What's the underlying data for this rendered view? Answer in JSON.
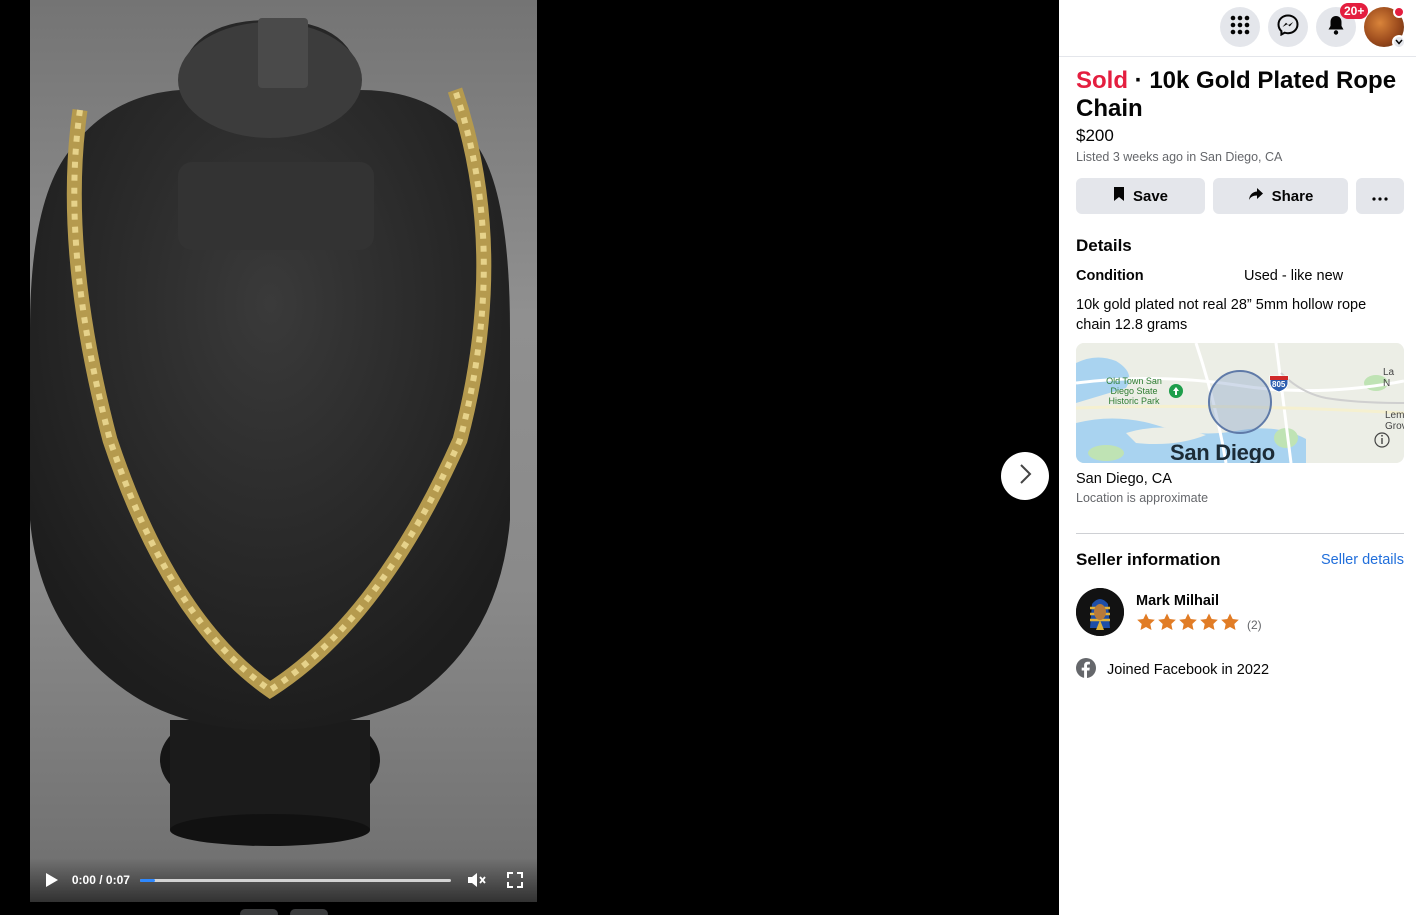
{
  "video": {
    "time": "0:00 / 0:07",
    "progress_fraction": 0.05
  },
  "icons": {
    "play": "play-icon",
    "mute": "speaker-muted-icon",
    "fullscreen": "fullscreen-icon",
    "next": "chevron-right-icon",
    "menu": "grid-menu-icon",
    "messenger": "messenger-icon",
    "notifications": "bell-icon",
    "save": "bookmark-icon",
    "share": "share-arrow-icon",
    "more": "ellipsis-icon",
    "facebook": "facebook-icon",
    "star": "star-icon"
  },
  "topbar": {
    "notification_badge": "20+"
  },
  "listing": {
    "status": "Sold",
    "separator": " · ",
    "title": "10k Gold Plated Rope Chain",
    "price": "$200",
    "listed": "Listed 3 weeks ago in San Diego, CA"
  },
  "actions": {
    "save": "Save",
    "share": "Share"
  },
  "details": {
    "heading": "Details",
    "condition_label": "Condition",
    "condition_value": "Used - like new",
    "description": "10k gold plated not real 28” 5mm hollow rope chain 12.8 grams"
  },
  "map": {
    "park_label": "Old Town San Diego State Historic Park",
    "park_line1": "Old Town San",
    "park_line2": "Diego State",
    "park_line3": "Historic Park",
    "highway": "805",
    "city_label": "San Diego",
    "edge_label_1": "La N",
    "edge_label_2": "Lemo",
    "edge_label_3": "Grov"
  },
  "location": {
    "name": "San Diego, CA",
    "note": "Location is approximate"
  },
  "seller": {
    "heading": "Seller information",
    "details_link": "Seller details",
    "name": "Mark Milhail",
    "rating_stars": 5,
    "rating_count": "(2)",
    "joined": "Joined Facebook in 2022"
  },
  "colors": {
    "sold": "#e41e3f",
    "link": "#216fdb",
    "star": "#e17c25",
    "progress": "#2d88ff"
  }
}
